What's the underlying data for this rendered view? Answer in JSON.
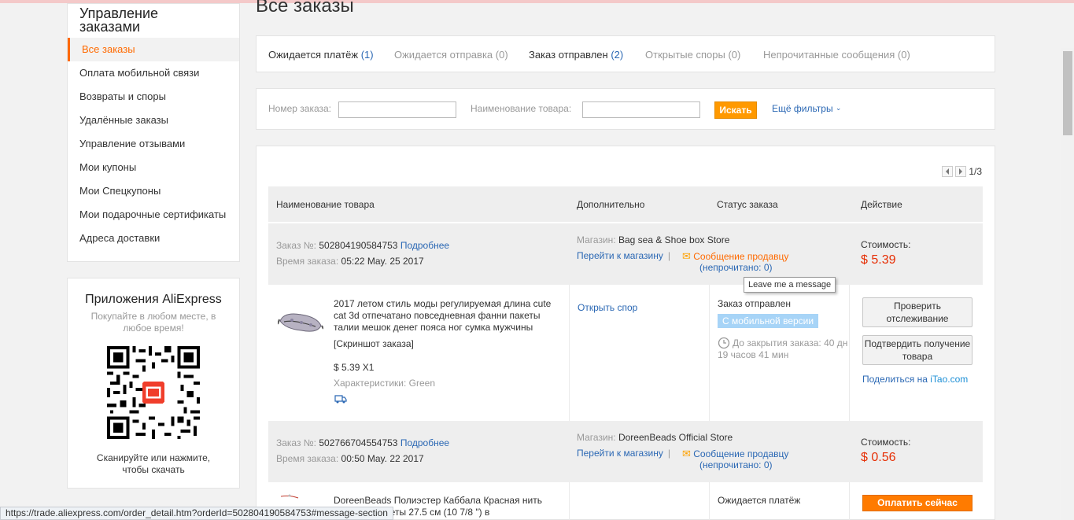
{
  "sidebar": {
    "title": "Управление заказами",
    "items": [
      {
        "label": "Все заказы"
      },
      {
        "label": "Оплата мобильной связи"
      },
      {
        "label": "Возвраты и споры"
      },
      {
        "label": "Удалённые заказы"
      },
      {
        "label": "Управление отзывами"
      },
      {
        "label": "Мои купоны"
      },
      {
        "label": "Мои Спецкупоны"
      },
      {
        "label": "Мои подарочные сертификаты"
      },
      {
        "label": "Адреса доставки"
      }
    ],
    "active_index": 0
  },
  "app_promo": {
    "title": "Приложения AliExpress",
    "subtitle": "Покупайте в любом месте, в любое время!",
    "scan_text": "Сканируйте или нажмите, чтобы скачать"
  },
  "page": {
    "title": "Все заказы"
  },
  "tabs": [
    {
      "label": "Ожидается платёж",
      "count": "(1)"
    },
    {
      "label": "Ожидается отправка",
      "count": "(0)"
    },
    {
      "label": "Заказ отправлен",
      "count": "(2)"
    },
    {
      "label": "Открытые споры",
      "count": "(0)"
    },
    {
      "label": "Непрочитанные сообщения",
      "count": "(0)"
    }
  ],
  "filters": {
    "order_no_label": "Номер заказа:",
    "product_label": "Наименование товара:",
    "search_button": "Искать",
    "more_filters": "Ещё фильтры"
  },
  "pager": {
    "text": "1/3"
  },
  "table_header": {
    "product": "Наименование товара",
    "extra": "Дополнительно",
    "status": "Статус заказа",
    "action": "Действие"
  },
  "orders": [
    {
      "order_label": "Заказ №:",
      "order_no": "502804190584753",
      "details_link": "Подробнее",
      "time_label": "Время заказа:",
      "time": "05:22 May. 25 2017",
      "store_label": "Магазин:",
      "store": "Bag sea & Shoe box Store",
      "store_link": "Перейти к магазину",
      "message_link": "Сообщение продавцу",
      "unread": "(непрочитано: 0)",
      "cost_label": "Стоимость:",
      "cost": "$ 5.39",
      "product_name": "2017 летом стиль моды регулируемая длина cute cat 3d отпечатано повседневная фанни пакеты талии мешок денег пояса ног сумка мужчины",
      "snapshot": "[Скриншот заказа]",
      "qty": "$ 5.39 X1",
      "attrs": "Характеристики: Green",
      "dispute_link": "Открыть спор",
      "status": "Заказ отправлен",
      "mobile_badge": "С мобильной версии",
      "timer": "До закрытия заказа: 40 дн 19 часов 41 мин",
      "btn_track": "Проверить отслеживание",
      "btn_confirm": "Подтвердить получение товара",
      "share_prefix": "Поделиться на ",
      "share_site": "iTao.com"
    },
    {
      "order_label": "Заказ №:",
      "order_no": "502766704554753",
      "details_link": "Подробнее",
      "time_label": "Время заказа:",
      "time": "00:50 May. 22 2017",
      "store_label": "Магазин:",
      "store": "DoreenBeads Official Store",
      "store_link": "Перейти к магазину",
      "message_link": "Сообщение продавцу",
      "unread": "(непрочитано: 0)",
      "cost_label": "Стоимость:",
      "cost": "$ 0.56",
      "product_name": "DoreenBeads Полиэстер Каббала Красная нить ружба Браслеты 27.5 см (10 7/8 \") в",
      "status": "Ожидается платёж",
      "btn_pay": "Оплатить сейчас"
    }
  ],
  "tooltip": "Leave me a message",
  "status_url": "https://trade.aliexpress.com/order_detail.htm?orderId=502804190584753#message-section",
  "colors": {
    "accent": "#ff6a00",
    "link": "#2b68b4",
    "price": "#e62e04"
  }
}
